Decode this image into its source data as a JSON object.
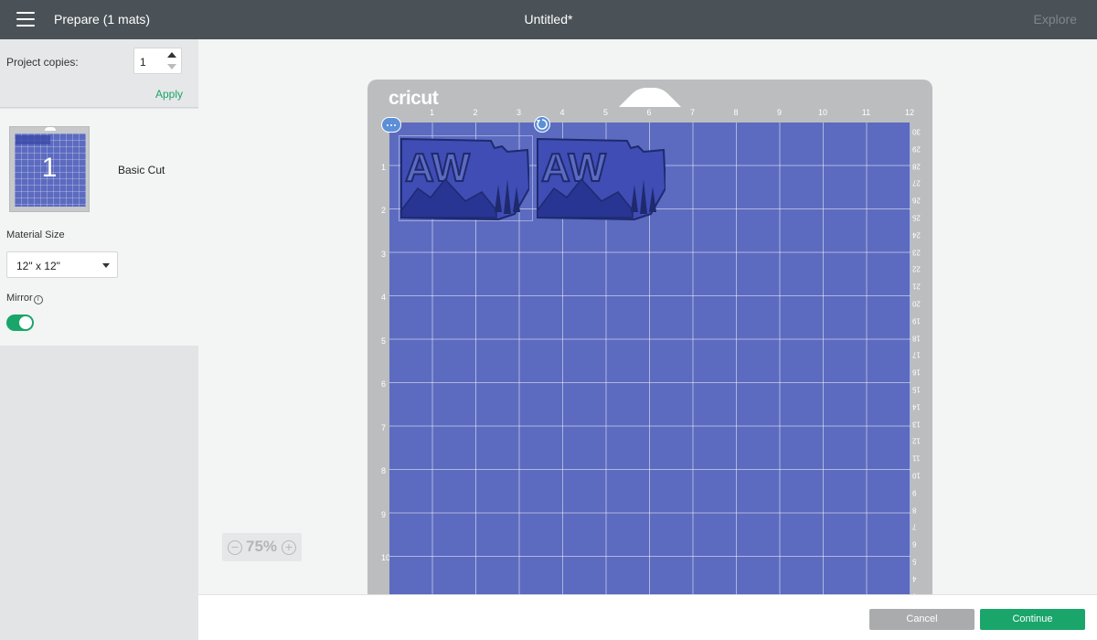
{
  "header": {
    "app_title": "Prepare (1 mats)",
    "document_title": "Untitled*",
    "explore_label": "Explore"
  },
  "left_panel": {
    "project_copies_label": "Project copies:",
    "project_copies_value": "1",
    "apply_label": "Apply",
    "mat": {
      "number": "1",
      "label": "Basic Cut"
    },
    "material_size_label": "Material Size",
    "material_size_value": "12\" x 12\"",
    "mirror_label": "Mirror",
    "mirror_info_icon": "i",
    "mirror_enabled": true
  },
  "canvas": {
    "brand_logo": "cricut",
    "top_ruler": [
      "1",
      "2",
      "3",
      "4",
      "5",
      "6",
      "7",
      "8",
      "9",
      "10",
      "11",
      "12"
    ],
    "left_ruler": [
      "1",
      "2",
      "3",
      "4",
      "5",
      "6",
      "7",
      "8",
      "9",
      "10"
    ],
    "right_ruler": [
      "30",
      "29",
      "28",
      "27",
      "26",
      "25",
      "24",
      "23",
      "22",
      "21",
      "20",
      "19",
      "18",
      "17",
      "16",
      "15",
      "14",
      "13",
      "12",
      "11",
      "10",
      "9",
      "8",
      "7",
      "6",
      "5",
      "4",
      "3"
    ],
    "design_text": "AW",
    "mat_color": "#5c6bc0",
    "zoom_out_symbol": "−",
    "zoom_value": "75%",
    "zoom_in_symbol": "+"
  },
  "footer": {
    "cancel_label": "Cancel",
    "continue_label": "Continue"
  },
  "colors": {
    "header_bg": "#4a5257",
    "accent": "#1aa56b",
    "mat_grid": "#5c6bc0",
    "design_stroke": "#1f2a6e"
  }
}
